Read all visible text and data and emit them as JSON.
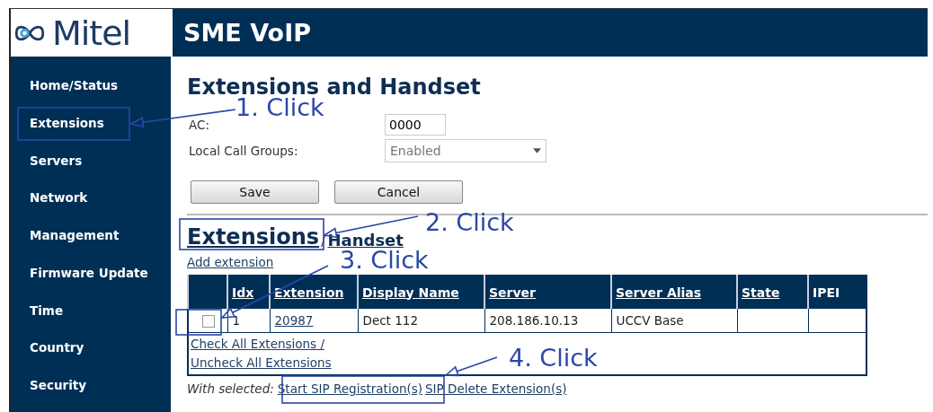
{
  "header": {
    "logo_text": "Mitel",
    "title": "SME VoIP"
  },
  "sidebar": {
    "items": [
      {
        "label": "Home/Status",
        "selected": false
      },
      {
        "label": "Extensions",
        "selected": false
      },
      {
        "label": "Servers",
        "selected": false
      },
      {
        "label": "Network",
        "selected": false
      },
      {
        "label": "Management",
        "selected": false
      },
      {
        "label": "Firmware Update",
        "selected": false
      },
      {
        "label": "Time",
        "selected": false
      },
      {
        "label": "Country",
        "selected": false
      },
      {
        "label": "Security",
        "selected": false
      }
    ]
  },
  "page_title": "Extensions and Handset",
  "form": {
    "ac": {
      "label": "AC:",
      "value": "0000"
    },
    "local_call_groups": {
      "label": "Local Call Groups:",
      "value": "Enabled",
      "disabled": true
    }
  },
  "buttons": [
    "Save",
    "Cancel"
  ],
  "tab_separator": "/",
  "tabs": [
    {
      "label": "Extensions",
      "selected": true
    },
    {
      "label": "Handset",
      "selected": false
    }
  ],
  "add_link": "Add extension",
  "table": {
    "columns": [
      {
        "label": "Idx",
        "sortable": true
      },
      {
        "label": "Extension",
        "sortable": true
      },
      {
        "label": "Display Name",
        "sortable": true
      },
      {
        "label": "Server",
        "sortable": true
      },
      {
        "label": "Server Alias",
        "sortable": true
      },
      {
        "label": "State",
        "sortable": true
      },
      {
        "label": "IPEI",
        "sortable": false
      }
    ],
    "rows": [
      {
        "checked": false,
        "idx": "1",
        "extension": "20987",
        "display_name": "Dect 112",
        "server": "208.186.10.13",
        "server_alias": "UCCV Base"
      }
    ],
    "check_all": "Check All Extensions /",
    "uncheck_all": "Uncheck All Extensions"
  },
  "with_selected": {
    "label": "With selected:",
    "actions": [
      "Start SIP Registration(s)",
      "SIP Delete Extension(s)"
    ]
  },
  "annotations": [
    {
      "label": "1. Click"
    },
    {
      "label": "2. Click"
    },
    {
      "label": "3. Click"
    },
    {
      "label": "4. Click"
    }
  ]
}
